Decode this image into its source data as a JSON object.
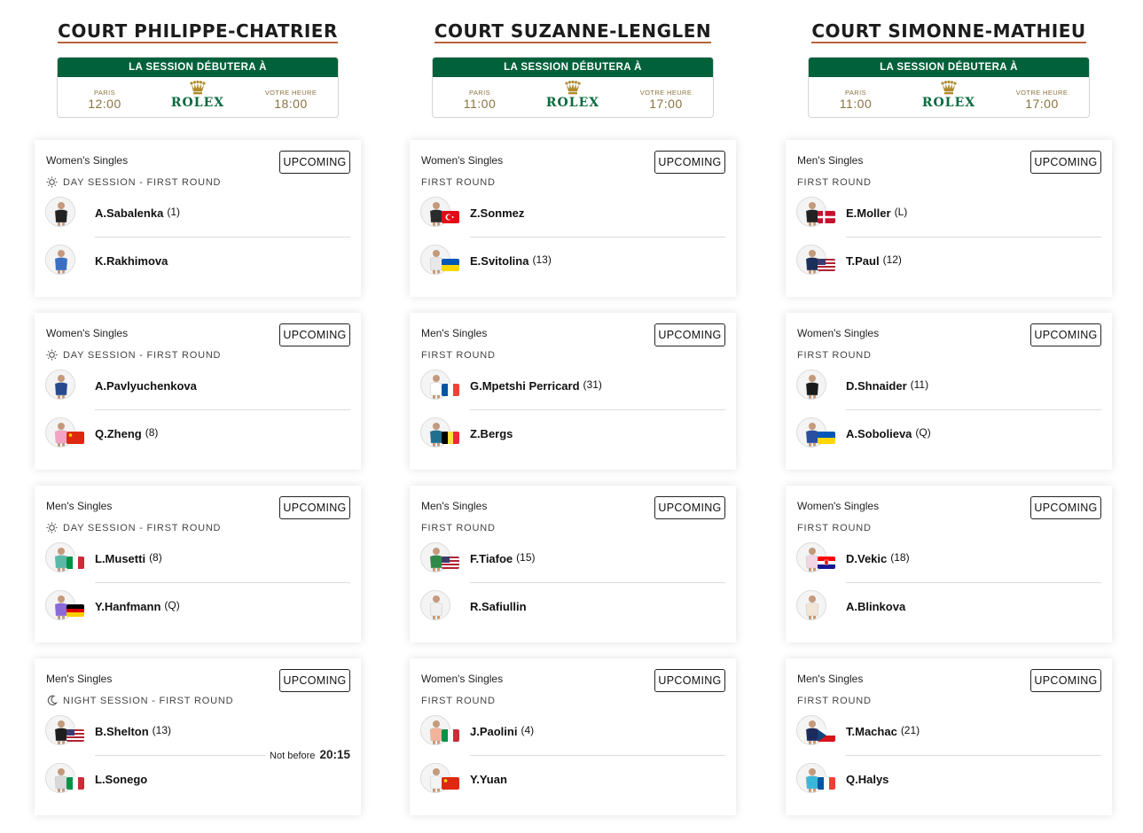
{
  "session_header": "LA SESSION DÉBUTERA À",
  "paris_label": "PARIS",
  "local_label": "VOTRE HEURE",
  "rolex_brand": "ROLEX",
  "courts": [
    {
      "name": "COURT PHILIPPE-CHATRIER",
      "paris_time": "12:00",
      "local_time": "18:00",
      "matches": [
        {
          "event": "Women's Singles",
          "status": "UPCOMING",
          "round_icon": "sun-icon",
          "round": "DAY SESSION - FIRST ROUND",
          "p1": {
            "name": "A.Sabalenka",
            "seed": "(1)",
            "flag": "none",
            "shirt": "#222222"
          },
          "p2": {
            "name": "K.Rakhimova",
            "seed": "",
            "flag": "none",
            "shirt": "#3a6fc4"
          }
        },
        {
          "event": "Women's Singles",
          "status": "UPCOMING",
          "round_icon": "sun-icon",
          "round": "DAY SESSION - FIRST ROUND",
          "p1": {
            "name": "A.Pavlyuchenkova",
            "seed": "",
            "flag": "none",
            "shirt": "#274a8f"
          },
          "p2": {
            "name": "Q.Zheng",
            "seed": "(8)",
            "flag": "china",
            "shirt": "#f3a3c4"
          }
        },
        {
          "event": "Men's Singles",
          "status": "UPCOMING",
          "round_icon": "sun-icon",
          "round": "DAY SESSION - FIRST ROUND",
          "p1": {
            "name": "L.Musetti",
            "seed": "(8)",
            "flag": "italy",
            "shirt": "#5ab8a8"
          },
          "p2": {
            "name": "Y.Hanfmann",
            "seed": "(Q)",
            "flag": "germany",
            "shirt": "#8a6ad6"
          }
        },
        {
          "event": "Men's Singles",
          "status": "UPCOMING",
          "round_icon": "moon-icon",
          "round": "NIGHT SESSION - FIRST ROUND",
          "p1": {
            "name": "B.Shelton",
            "seed": "(13)",
            "flag": "usa",
            "shirt": "#1e1e1e"
          },
          "p2": {
            "name": "L.Sonego",
            "seed": "",
            "flag": "italy",
            "shirt": "#d8d8d8"
          },
          "not_before_label": "Not before",
          "not_before_time": "20:15"
        }
      ]
    },
    {
      "name": "COURT SUZANNE-LENGLEN",
      "paris_time": "11:00",
      "local_time": "17:00",
      "matches": [
        {
          "event": "Women's Singles",
          "status": "UPCOMING",
          "round_icon": "",
          "round": "FIRST ROUND",
          "p1": {
            "name": "Z.Sonmez",
            "seed": "",
            "flag": "turkey",
            "shirt": "#2a2a2a"
          },
          "p2": {
            "name": "E.Svitolina",
            "seed": "(13)",
            "flag": "ukraine",
            "shirt": "#e8e8e8"
          }
        },
        {
          "event": "Men's Singles",
          "status": "UPCOMING",
          "round_icon": "",
          "round": "FIRST ROUND",
          "p1": {
            "name": "G.Mpetshi Perricard",
            "seed": "(31)",
            "flag": "france",
            "shirt": "#ffffff"
          },
          "p2": {
            "name": "Z.Bergs",
            "seed": "",
            "flag": "belgium",
            "shirt": "#1f6f8f"
          }
        },
        {
          "event": "Men's Singles",
          "status": "UPCOMING",
          "round_icon": "",
          "round": "FIRST ROUND",
          "p1": {
            "name": "F.Tiafoe",
            "seed": "(15)",
            "flag": "usa",
            "shirt": "#2f8a4a"
          },
          "p2": {
            "name": "R.Safiullin",
            "seed": "",
            "flag": "none",
            "shirt": "#f0f0f0"
          }
        },
        {
          "event": "Women's Singles",
          "status": "UPCOMING",
          "round_icon": "",
          "round": "FIRST ROUND",
          "p1": {
            "name": "J.Paolini",
            "seed": "(4)",
            "flag": "italy",
            "shirt": "#f2b39a"
          },
          "p2": {
            "name": "Y.Yuan",
            "seed": "",
            "flag": "china",
            "shirt": "#f4f4f4"
          }
        }
      ]
    },
    {
      "name": "COURT SIMONNE-MATHIEU",
      "paris_time": "11:00",
      "local_time": "17:00",
      "matches": [
        {
          "event": "Men's Singles",
          "status": "UPCOMING",
          "round_icon": "",
          "round": "FIRST ROUND",
          "p1": {
            "name": "E.Moller",
            "seed": "(L)",
            "flag": "denmark",
            "shirt": "#222222"
          },
          "p2": {
            "name": "T.Paul",
            "seed": "(12)",
            "flag": "usa",
            "shirt": "#1c2e5a"
          }
        },
        {
          "event": "Women's Singles",
          "status": "UPCOMING",
          "round_icon": "",
          "round": "FIRST ROUND",
          "p1": {
            "name": "D.Shnaider",
            "seed": "(11)",
            "flag": "none",
            "shirt": "#1a1a1a"
          },
          "p2": {
            "name": "A.Sobolieva",
            "seed": "(Q)",
            "flag": "ukraine",
            "shirt": "#2a4ea0"
          }
        },
        {
          "event": "Women's Singles",
          "status": "UPCOMING",
          "round_icon": "",
          "round": "FIRST ROUND",
          "p1": {
            "name": "D.Vekic",
            "seed": "(18)",
            "flag": "croatia",
            "shirt": "#f1d5e4"
          },
          "p2": {
            "name": "A.Blinkova",
            "seed": "",
            "flag": "none",
            "shirt": "#f1e6d6"
          }
        },
        {
          "event": "Men's Singles",
          "status": "UPCOMING",
          "round_icon": "",
          "round": "FIRST ROUND",
          "p1": {
            "name": "T.Machac",
            "seed": "(21)",
            "flag": "czech",
            "shirt": "#1a2a5a"
          },
          "p2": {
            "name": "Q.Halys",
            "seed": "",
            "flag": "france",
            "shirt": "#39b7d8"
          }
        }
      ]
    }
  ]
}
